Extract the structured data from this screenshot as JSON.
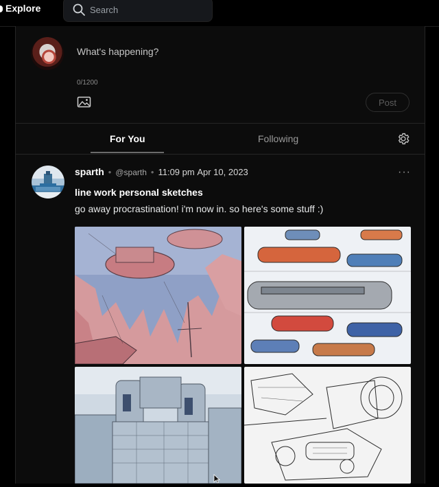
{
  "header": {
    "explore_label": "Explore",
    "search_placeholder": "Search"
  },
  "composer": {
    "placeholder": "What's happening?",
    "counter": "0/1200",
    "post_label": "Post"
  },
  "tabs": [
    {
      "label": "For You",
      "active": true
    },
    {
      "label": "Following",
      "active": false
    }
  ],
  "post": {
    "author_name": "sparth",
    "handle": "@sparth",
    "time": "11:09 pm",
    "date": "Apr 10, 2023",
    "more_label": "···",
    "title": "line work personal sketches",
    "text": "go away procrastination! i'm now in. so here's some stuff :)",
    "images": [
      {
        "icon": "airship-sketch-image"
      },
      {
        "icon": "spaceships-sketch-image"
      },
      {
        "icon": "city-sketch-image"
      },
      {
        "icon": "engine-lineart-image"
      }
    ]
  },
  "colors": {
    "background": "#000000",
    "panel": "#0c0c0c",
    "border": "#262626",
    "text": "#e7e9ea",
    "muted": "#9a9a9a"
  }
}
